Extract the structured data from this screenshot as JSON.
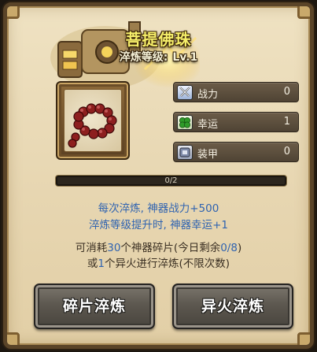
{
  "header": {
    "title": "菩提佛珠",
    "level_label": "淬炼等级:",
    "level_value": "Lv.1"
  },
  "stats": [
    {
      "icon": "crossed-swords-icon",
      "label": "战力",
      "value": "0"
    },
    {
      "icon": "four-leaf-clover-icon",
      "label": "幸运",
      "value": "1"
    },
    {
      "icon": "armor-scroll-icon",
      "label": "装甲",
      "value": "0"
    }
  ],
  "progress": {
    "text": "0/2",
    "fraction": 0
  },
  "info": {
    "line1": "每次淬炼, 神器战力+500",
    "line2": "淬炼等级提升时, 神器幸运+1",
    "line3_a": "可消耗",
    "line3_num": "30",
    "line3_b": "个神器碎片(今日剩余",
    "line3_rem": "0/8",
    "line3_c": ")",
    "line4_a": "或",
    "line4_num": "1",
    "line4_b": "个异火进行淬炼(不限次数)"
  },
  "buttons": {
    "shard_refine": "碎片淬炼",
    "fire_refine": "异火淬炼"
  },
  "colors": {
    "title": "#f6ef6a",
    "info_blue": "#2f63b0",
    "panel_bg": "#e7d6b1",
    "frame_brown": "#5a4428"
  }
}
